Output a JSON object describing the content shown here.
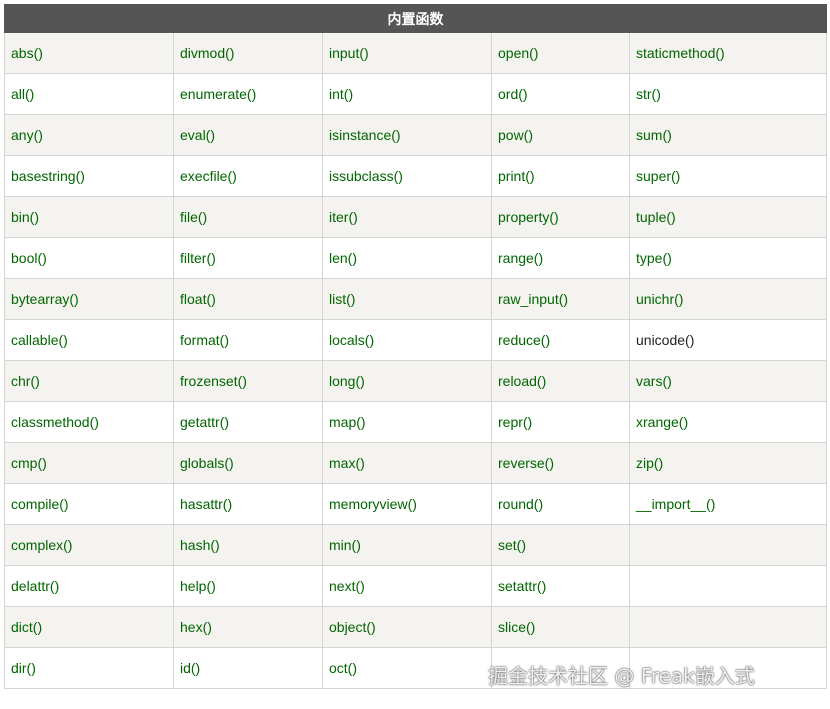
{
  "table": {
    "title": "内置函数",
    "rows": [
      [
        "abs()",
        "divmod()",
        "input()",
        "open()",
        "staticmethod()"
      ],
      [
        "all()",
        "enumerate()",
        "int()",
        "ord()",
        "str()"
      ],
      [
        "any()",
        "eval()",
        "isinstance()",
        "pow()",
        "sum()"
      ],
      [
        "basestring()",
        "execfile()",
        "issubclass()",
        "print()",
        "super()"
      ],
      [
        "bin()",
        "file()",
        "iter()",
        "property()",
        "tuple()"
      ],
      [
        "bool()",
        "filter()",
        "len()",
        "range()",
        "type()"
      ],
      [
        "bytearray()",
        "float()",
        "list()",
        "raw_input()",
        "unichr()"
      ],
      [
        "callable()",
        "format()",
        "locals()",
        "reduce()",
        "unicode()"
      ],
      [
        "chr()",
        "frozenset()",
        "long()",
        "reload()",
        "vars()"
      ],
      [
        "classmethod()",
        "getattr()",
        "map()",
        "repr()",
        "xrange()"
      ],
      [
        "cmp()",
        "globals()",
        "max()",
        "reverse()",
        "zip()"
      ],
      [
        "compile()",
        "hasattr()",
        "memoryview()",
        "round()",
        "__import__()"
      ],
      [
        "complex()",
        "hash()",
        "min()",
        "set()",
        ""
      ],
      [
        "delattr()",
        "help()",
        "next()",
        "setattr()",
        ""
      ],
      [
        "dict()",
        "hex()",
        "object()",
        "slice()",
        ""
      ],
      [
        "dir()",
        "id()",
        "oct()",
        "",
        ""
      ]
    ]
  },
  "watermark": "掘金技术社区 @ Freak嵌入式",
  "colors": {
    "header_bg": "#555555",
    "link_text": "#006600",
    "plain_text": "#222222",
    "odd_row_bg": "#f4f3ef",
    "even_row_bg": "#ffffff",
    "border": "#d4d4d4"
  }
}
